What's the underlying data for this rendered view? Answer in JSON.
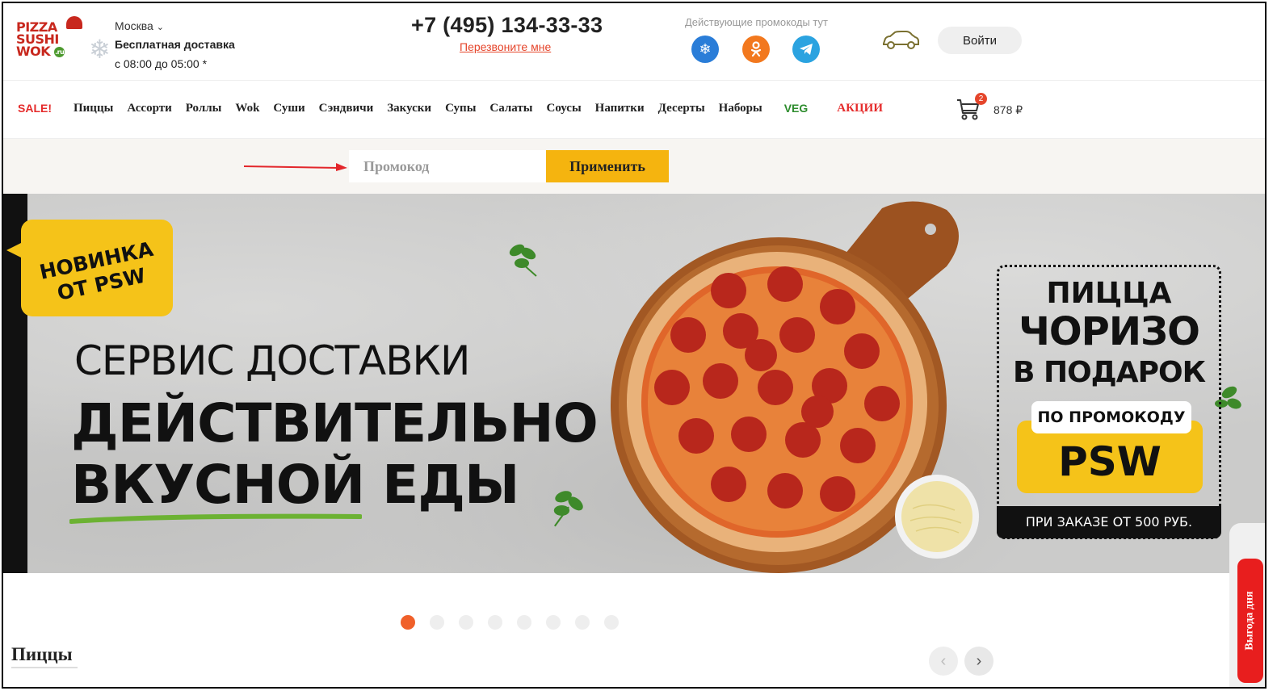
{
  "header": {
    "logo": {
      "line1": "PIZZA",
      "line2": "SUSHI",
      "line3": "WOK",
      "ru": ".ru"
    },
    "city": "Москва",
    "delivery": "Бесплатная доставка",
    "hours": "с 08:00 до 05:00 *",
    "phone": "+7 (495) 134-33-33",
    "callback": "Перезвоните мне",
    "promo_note": "Действующие промокоды тут",
    "login": "Войти"
  },
  "nav": {
    "items": [
      "SALE!",
      "Пиццы",
      "Ассорти",
      "Роллы",
      "Wok",
      "Суши",
      "Сэндвичи",
      "Закуски",
      "Супы",
      "Салаты",
      "Соусы",
      "Напитки",
      "Десерты",
      "Наборы",
      "VEG",
      "АКЦИИ"
    ]
  },
  "cart": {
    "count": "2",
    "sum": "878 ₽"
  },
  "promo": {
    "placeholder": "Промокод",
    "apply": "Применить"
  },
  "banner": {
    "badge": "НОВИНКА ОТ PSW",
    "service": "СЕРВИС ДОСТАВКИ",
    "headline1": "ДЕЙСТВИТЕЛЬНО",
    "headline2": "ВКУСНОЙ ЕДЫ",
    "box": {
      "line1": "ПИЦЦА",
      "line2": "ЧОРИЗО",
      "line3": "В ПОДАРОК",
      "by_code": "ПО ПРОМОКОДУ",
      "code": "PSW",
      "condition": "ПРИ ЗАКАЗЕ ОТ 500 РУБ."
    }
  },
  "side_tab": "Выгода дня",
  "section": {
    "title": "Пиццы"
  },
  "colors": {
    "accent": "#f5b40f",
    "red": "#e52b2b",
    "orange": "#f0602a",
    "green": "#2d8c2d"
  }
}
